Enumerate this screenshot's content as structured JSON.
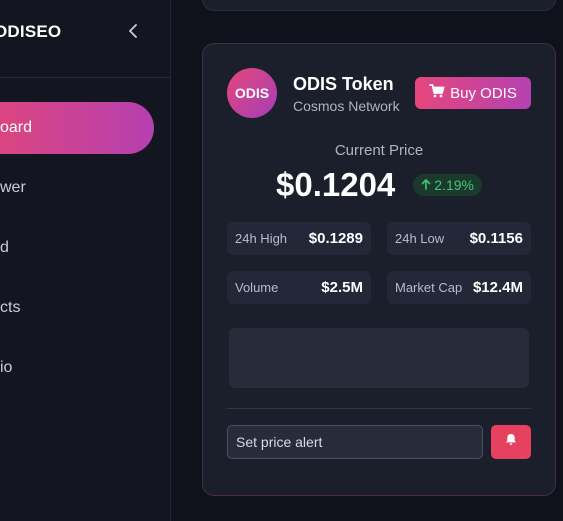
{
  "sidebar": {
    "brand": "ODISEO",
    "items": [
      {
        "label": "oard",
        "active": true
      },
      {
        "label": "wer"
      },
      {
        "label": "d"
      },
      {
        "label": "cts"
      },
      {
        "label": "io"
      }
    ]
  },
  "token": {
    "logo_text": "ODIS",
    "name": "ODIS Token",
    "network": "Cosmos Network",
    "buy_label": "Buy ODIS",
    "price_label": "Current Price",
    "price": "$0.1204",
    "change": "2.19%",
    "change_direction": "up",
    "stats": {
      "high_label": "24h High",
      "high_value": "$0.1289",
      "low_label": "24h Low",
      "low_value": "$0.1156",
      "volume_label": "Volume",
      "volume_value": "$2.5M",
      "mcap_label": "Market Cap",
      "mcap_value": "$12.4M"
    },
    "alert_placeholder": "Set price alert"
  },
  "colors": {
    "accent_start": "#e6467c",
    "accent_end": "#b542b0",
    "positive": "#42c57a",
    "alert": "#e6415f"
  },
  "icons": {
    "collapse": "chevron-left-icon",
    "buy": "cart-icon",
    "change": "arrow-up-icon",
    "alert": "bell-icon"
  }
}
